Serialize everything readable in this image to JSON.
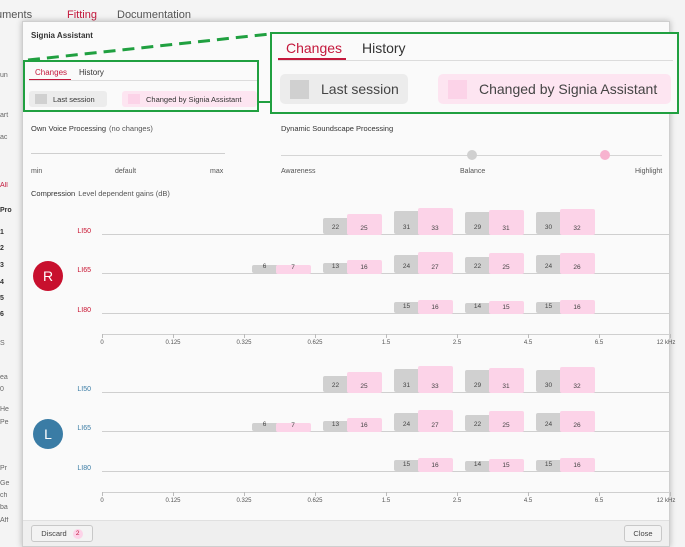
{
  "colors": {
    "accent": "#c4183c",
    "right_ear": "#c8102e",
    "left_ear": "#3a7ca5",
    "last_session": "#d0d0d0",
    "changed": "#fcd3e8",
    "highlight": "#20a040"
  },
  "background": {
    "menu": [
      "uments",
      "Fitting",
      "Documentation"
    ],
    "side": [
      "un",
      "art",
      "ac",
      "All",
      "Pro",
      "1",
      "2",
      "3",
      "4",
      "5",
      "6",
      "S",
      "ea",
      "0",
      "He",
      "Pe",
      "Pr",
      "Ge",
      "ch",
      "ba",
      "Aff"
    ]
  },
  "dialog": {
    "title": "Signia Assistant",
    "tabs": [
      {
        "label": "Changes",
        "active": true
      },
      {
        "label": "History",
        "active": false
      }
    ],
    "legend": {
      "last_session": "Last session",
      "changed": "Changed by Signia Assistant"
    },
    "own_voice": {
      "label": "Own Voice Processing",
      "note": "(no changes)",
      "min": "min",
      "default": "default",
      "max": "max"
    },
    "dynamic_soundscape": {
      "label": "Dynamic Soundscape Processing",
      "awareness": "Awareness",
      "balance": "Balance",
      "highlight": "Highlight",
      "last_session_level": 0.5,
      "changed_level": 0.85
    },
    "compression": {
      "label": "Compression",
      "note": "Level dependent gains (dB)",
      "levels": [
        "LI50",
        "LI65",
        "LI80"
      ],
      "frequencies": [
        "0",
        "0.125",
        "0.325",
        "0.625",
        "1.5",
        "2.5",
        "4.5",
        "6.5",
        "12 kHz"
      ],
      "ears": [
        {
          "side": "R",
          "gains": {
            "LI50": [
              [
                null,
                null
              ],
              [
                null,
                null
              ],
              [
                null,
                null
              ],
              [
                22,
                25
              ],
              [
                31,
                33
              ],
              [
                29,
                31
              ],
              [
                30,
                32
              ]
            ],
            "LI65": [
              [
                null,
                null
              ],
              [
                null,
                null
              ],
              [
                6,
                7
              ],
              [
                13,
                16
              ],
              [
                24,
                27
              ],
              [
                22,
                25
              ],
              [
                24,
                26
              ]
            ],
            "LI80": [
              [
                null,
                null
              ],
              [
                null,
                null
              ],
              [
                null,
                null
              ],
              [
                null,
                null
              ],
              [
                15,
                16
              ],
              [
                14,
                15
              ],
              [
                15,
                16
              ]
            ]
          }
        },
        {
          "side": "L",
          "gains": {
            "LI50": [
              [
                null,
                null
              ],
              [
                null,
                null
              ],
              [
                null,
                null
              ],
              [
                22,
                25
              ],
              [
                31,
                33
              ],
              [
                29,
                31
              ],
              [
                30,
                32
              ]
            ],
            "LI65": [
              [
                null,
                null
              ],
              [
                null,
                null
              ],
              [
                6,
                7
              ],
              [
                13,
                16
              ],
              [
                24,
                27
              ],
              [
                22,
                25
              ],
              [
                24,
                26
              ]
            ],
            "LI80": [
              [
                null,
                null
              ],
              [
                null,
                null
              ],
              [
                null,
                null
              ],
              [
                null,
                null
              ],
              [
                15,
                16
              ],
              [
                14,
                15
              ],
              [
                15,
                16
              ]
            ]
          }
        }
      ]
    },
    "footer": {
      "discard": "Discard",
      "discard_count": "2",
      "close": "Close"
    }
  },
  "zoom": {
    "tabs": [
      "Changes",
      "History"
    ],
    "legend": [
      "Last session",
      "Changed by Signia Assistant"
    ]
  }
}
